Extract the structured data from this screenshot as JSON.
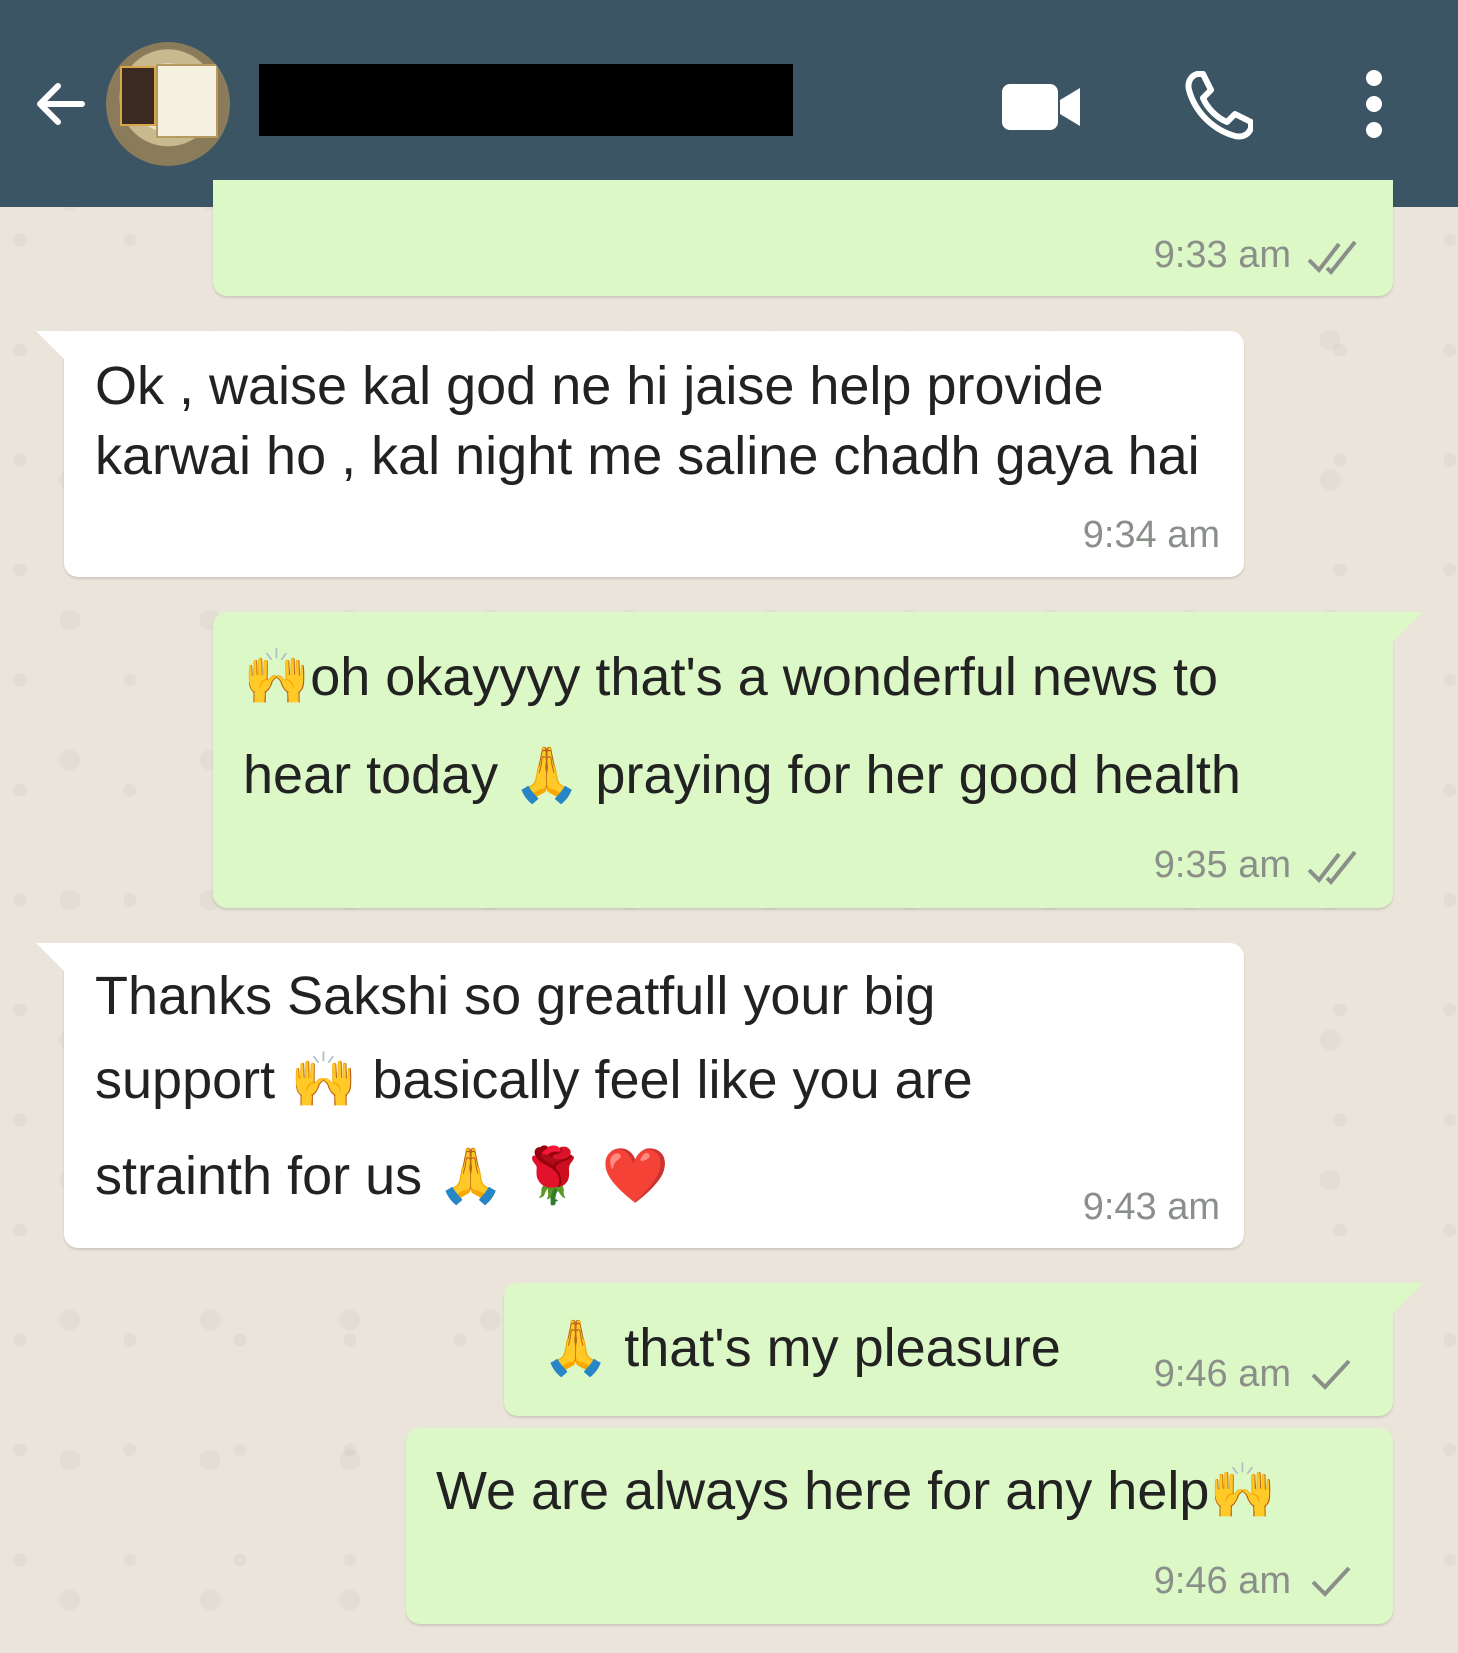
{
  "header": {
    "back_icon": "arrow-left-icon",
    "video_icon": "video-camera-icon",
    "call_icon": "phone-icon",
    "menu_icon": "more-vertical-icon",
    "background_color": "#3b5564"
  },
  "messages": [
    {
      "direction": "outgoing",
      "text": "",
      "time": "9:33 am",
      "status": "read"
    },
    {
      "direction": "incoming",
      "text": "Ok , waise kal god ne hi jaise help provide karwai ho , kal night me saline chadh gaya hai",
      "time": "9:34 am"
    },
    {
      "direction": "outgoing",
      "text_line1": "🙌oh okayyyy that's a wonderful news to",
      "text_line2": "hear today 🙏 praying for her good health",
      "time": "9:35 am",
      "status": "read"
    },
    {
      "direction": "incoming",
      "text_line1": "Thanks Sakshi so greatfull your big",
      "text_line2": "support 🙌 basically feel like you are",
      "text_line3": "strainth for us 🙏 🌹 ❤️",
      "time": "9:43 am"
    },
    {
      "direction": "outgoing",
      "text": "🙏 that's my pleasure",
      "time": "9:46 am",
      "status": "sent"
    },
    {
      "direction": "outgoing",
      "text": "We are always here for any help🙌",
      "time": "9:46 am",
      "status": "sent"
    }
  ],
  "colors": {
    "outgoing_bubble": "#dcf8c6",
    "incoming_bubble": "#ffffff",
    "chat_background": "#ebe4da"
  }
}
